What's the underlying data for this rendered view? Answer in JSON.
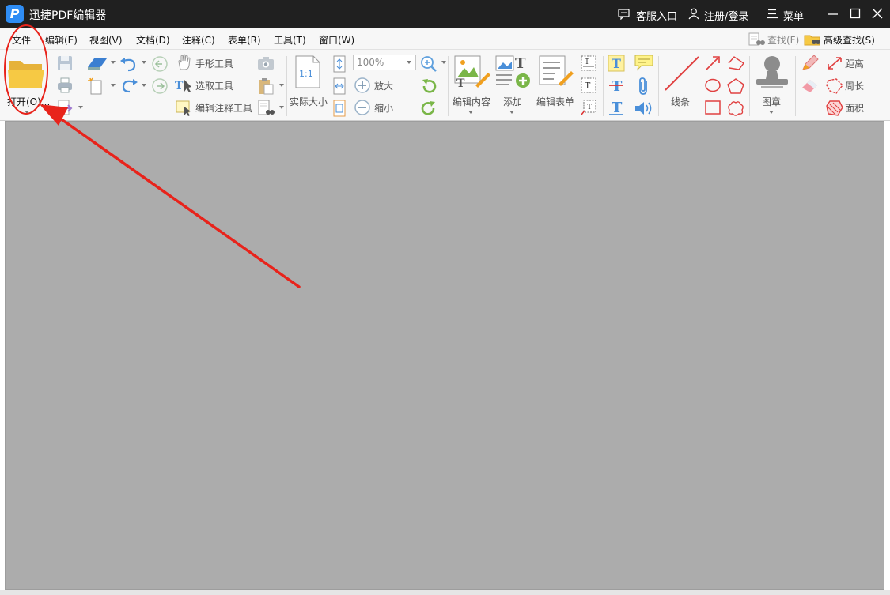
{
  "window": {
    "app_name": "迅捷PDF编辑器",
    "logo_letter": "P",
    "customer_service": "客服入口",
    "account": "注册/登录",
    "menu": "菜单"
  },
  "menubar": {
    "items": [
      "文件",
      "编辑(E)",
      "视图(V)",
      "文档(D)",
      "注释(C)",
      "表单(R)",
      "工具(T)",
      "窗口(W)"
    ],
    "find": "查找(F)",
    "advanced_find": "高级查找(S)"
  },
  "toolbar": {
    "open_label": "打开(O)...",
    "hand_tool": "手形工具",
    "select_tool": "选取工具",
    "edit_annot_tool": "编辑注释工具",
    "actual_size": "实际大小",
    "actual_size_icon_text": "1:1",
    "zoom_value": "100%",
    "zoom_in": "放大",
    "zoom_out": "缩小",
    "edit_content": "编辑内容",
    "add": "添加",
    "edit_form": "编辑表单",
    "lines": "线条",
    "stamp": "图章",
    "distance": "距离",
    "perimeter": "周长",
    "area": "面积"
  },
  "annotation": {
    "color": "#e8231b"
  },
  "colors": {
    "titlebar": "#202020",
    "workspace": "#acacac",
    "folder": "#f6c944",
    "accent_blue": "#4a8fd9"
  }
}
